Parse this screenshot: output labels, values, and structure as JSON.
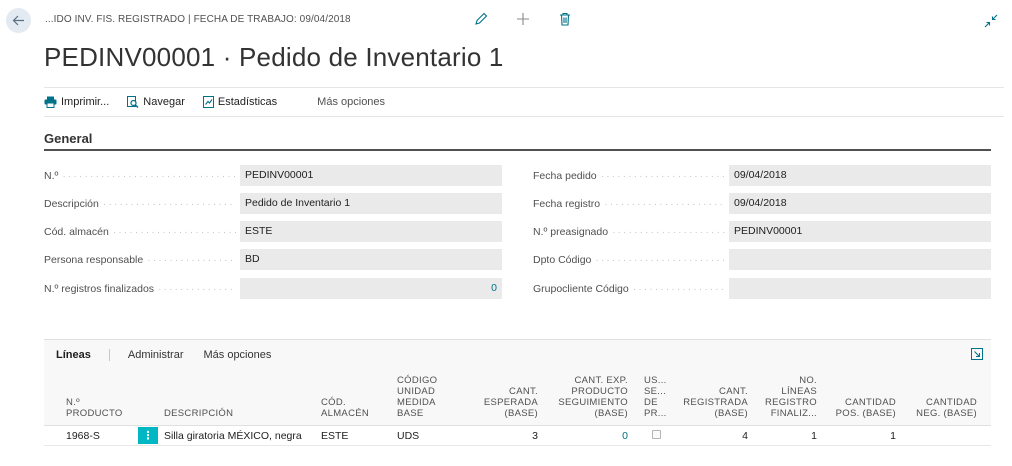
{
  "header": {
    "caption": "...IDO INV. FIS. REGISTRADO | FECHA DE TRABAJO: 09/04/2018",
    "title": "PEDINV00001 · Pedido de Inventario 1",
    "icons": [
      "back-arrow-icon",
      "edit-pencil-icon",
      "add-plus-icon",
      "delete-trash-icon",
      "collapse-icon"
    ]
  },
  "actions": {
    "print": "Imprimir...",
    "navigate": "Navegar",
    "statistics": "Estadísticas",
    "more": "Más opciones"
  },
  "general": {
    "title": "General",
    "left": [
      {
        "label": "N.º",
        "value": "PEDINV00001",
        "numeric": false
      },
      {
        "label": "Descripción",
        "value": "Pedido de Inventario 1",
        "numeric": false
      },
      {
        "label": "Cód. almacén",
        "value": "ESTE",
        "numeric": false
      },
      {
        "label": "Persona responsable",
        "value": "BD",
        "numeric": false
      },
      {
        "label": "N.º registros finalizados",
        "value": "0",
        "numeric": true
      }
    ],
    "right": [
      {
        "label": "Fecha pedido",
        "value": "09/04/2018",
        "numeric": false
      },
      {
        "label": "Fecha registro",
        "value": "09/04/2018",
        "numeric": false
      },
      {
        "label": "N.º preasignado",
        "value": "PEDINV00001",
        "numeric": false
      },
      {
        "label": "Dpto Código",
        "value": "",
        "numeric": false
      },
      {
        "label": "Grupocliente Código",
        "value": "",
        "numeric": false
      }
    ]
  },
  "lines": {
    "tab": "Líneas",
    "manage": "Administrar",
    "more": "Más opciones",
    "columns": [
      {
        "label": "N.º\nPRODUCTO",
        "align": "left"
      },
      {
        "label": "DESCRIPCIÓN",
        "align": "left"
      },
      {
        "label": "CÓD.\nALMACÉN",
        "align": "left"
      },
      {
        "label": "CÓDIGO\nUNIDAD\nMEDIDA\nBASE",
        "align": "left"
      },
      {
        "label": "CANT.\nESPERADA\n(BASE)",
        "align": "right"
      },
      {
        "label": "CANT. EXP.\nPRODUCTO\nSEGUIMIENTO\n(BASE)",
        "align": "right"
      },
      {
        "label": "US...\nSE...\nDE\nPR...",
        "align": "left"
      },
      {
        "label": "CANT.\nREGISTRADA\n(BASE)",
        "align": "right"
      },
      {
        "label": "NO.\nLÍNEAS\nREGISTRO\nFINALIZ...",
        "align": "right"
      },
      {
        "label": "CANTIDAD\nPOS. (BASE)",
        "align": "right"
      },
      {
        "label": "CANTIDAD\nNEG. (BASE)",
        "align": "right"
      }
    ],
    "rows": [
      {
        "item_no": "1968-S",
        "description": "Silla giratoria MÉXICO, negra",
        "location": "ESTE",
        "uom": "UDS",
        "qty_expected": "3",
        "qty_tracking": "0",
        "use_serial": false,
        "qty_recorded": "4",
        "lines_finished": "1",
        "qty_pos": "1",
        "qty_neg": ""
      }
    ]
  },
  "colors": {
    "accent": "#00b7c3",
    "link": "#00718a",
    "field_bg": "#eaeaea"
  }
}
